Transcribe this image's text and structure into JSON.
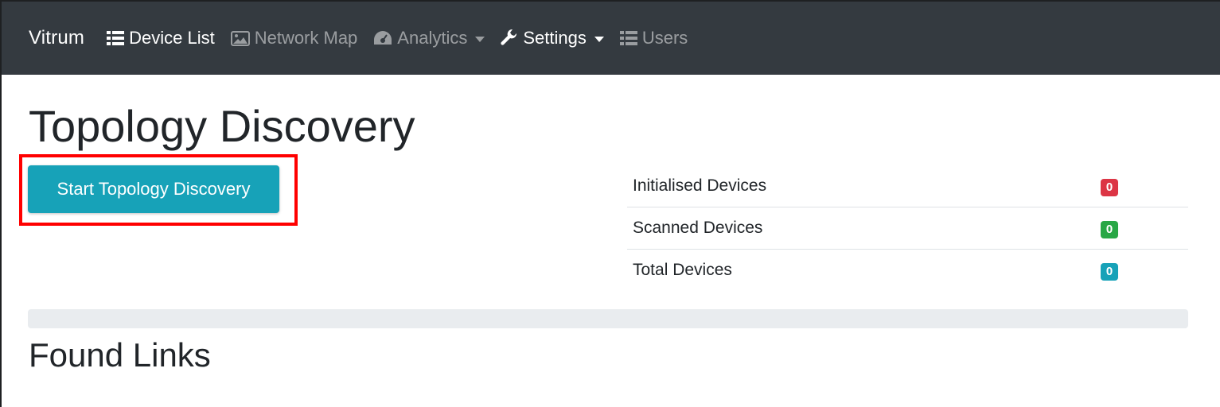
{
  "navbar": {
    "brand": "Vitrum",
    "items": [
      {
        "label": "Device List",
        "icon": "list-icon",
        "active": true,
        "dropdown": false
      },
      {
        "label": "Network Map",
        "icon": "image-icon",
        "active": false,
        "dropdown": false
      },
      {
        "label": "Analytics",
        "icon": "dashboard-icon",
        "active": false,
        "dropdown": true
      },
      {
        "label": "Settings",
        "icon": "wrench-icon",
        "active": true,
        "dropdown": true
      },
      {
        "label": "Users",
        "icon": "list-icon",
        "active": false,
        "dropdown": false
      }
    ]
  },
  "page": {
    "title": "Topology Discovery",
    "start_button_label": "Start Topology Discovery",
    "section_title": "Found Links"
  },
  "stats": [
    {
      "label": "Initialised Devices",
      "value": "0",
      "color": "#dc3545"
    },
    {
      "label": "Scanned Devices",
      "value": "0",
      "color": "#28a745"
    },
    {
      "label": "Total Devices",
      "value": "0",
      "color": "#17a2b8"
    }
  ],
  "progress": {
    "percent": 0
  },
  "colors": {
    "navbar_bg": "#343a40",
    "button_info": "#17a2b8",
    "highlight": "#ff0000"
  }
}
